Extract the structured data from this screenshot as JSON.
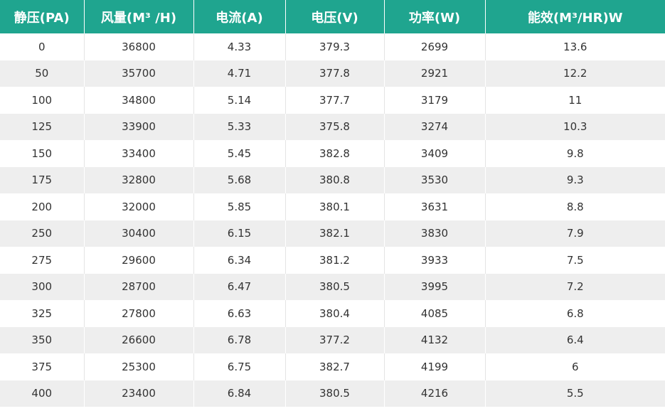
{
  "colors": {
    "header_bg": "#1fa58f",
    "header_text": "#ffffff",
    "row_alt_bg": "#eeeeee",
    "cell_text": "#333333"
  },
  "headers": [
    "静压(PA)",
    "风量(M³ /H)",
    "电流(A)",
    "电压(V)",
    "功率(W)",
    "能效(M³/HR)W"
  ],
  "rows": [
    [
      "0",
      "36800",
      "4.33",
      "379.3",
      "2699",
      "13.6"
    ],
    [
      "50",
      "35700",
      "4.71",
      "377.8",
      "2921",
      "12.2"
    ],
    [
      "100",
      "34800",
      "5.14",
      "377.7",
      "3179",
      "11"
    ],
    [
      "125",
      "33900",
      "5.33",
      "375.8",
      "3274",
      "10.3"
    ],
    [
      "150",
      "33400",
      "5.45",
      "382.8",
      "3409",
      "9.8"
    ],
    [
      "175",
      "32800",
      "5.68",
      "380.8",
      "3530",
      "9.3"
    ],
    [
      "200",
      "32000",
      "5.85",
      "380.1",
      "3631",
      "8.8"
    ],
    [
      "250",
      "30400",
      "6.15",
      "382.1",
      "3830",
      "7.9"
    ],
    [
      "275",
      "29600",
      "6.34",
      "381.2",
      "3933",
      "7.5"
    ],
    [
      "300",
      "28700",
      "6.47",
      "380.5",
      "3995",
      "7.2"
    ],
    [
      "325",
      "27800",
      "6.63",
      "380.4",
      "4085",
      "6.8"
    ],
    [
      "350",
      "26600",
      "6.78",
      "377.2",
      "4132",
      "6.4"
    ],
    [
      "375",
      "25300",
      "6.75",
      "382.7",
      "4199",
      "6"
    ],
    [
      "400",
      "23400",
      "6.84",
      "380.5",
      "4216",
      "5.5"
    ]
  ]
}
